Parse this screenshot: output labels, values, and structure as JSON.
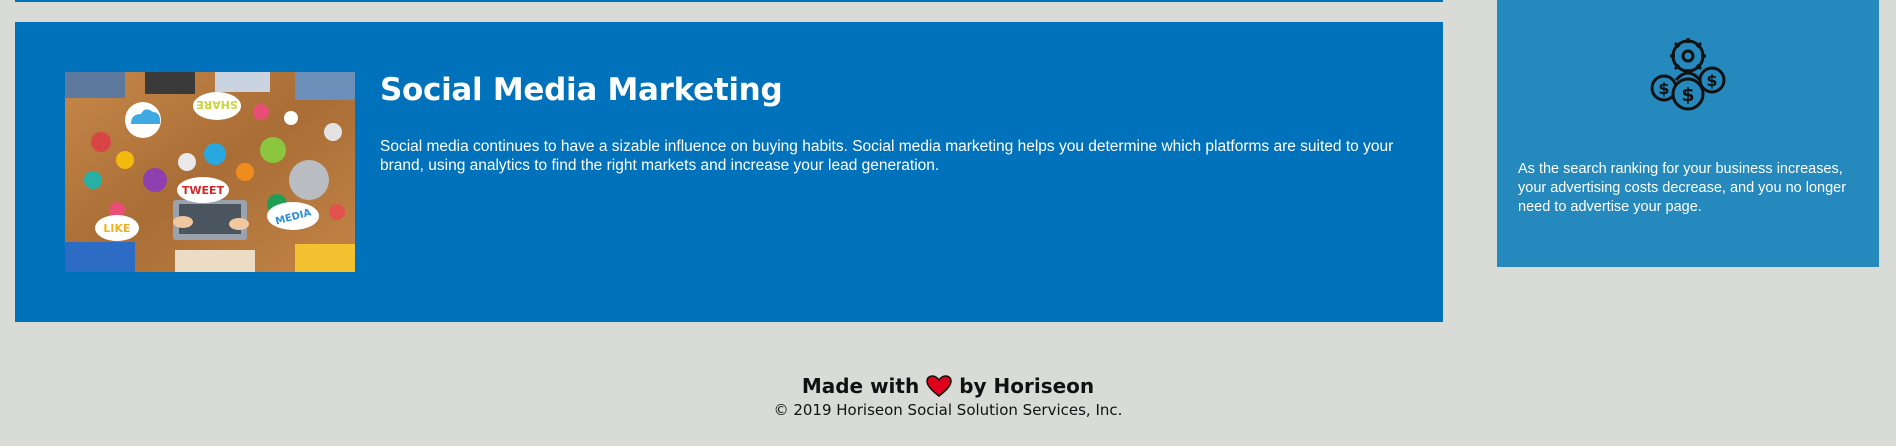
{
  "section": {
    "title": "Social Media Marketing",
    "body": "Social media continues to have a sizable influence on buying habits. Social media marketing helps you determine which platforms are suited to your brand, using analytics to find the right markets and increase your lead generation.",
    "image_alt": "social media marketing",
    "image_words": [
      "SHARE",
      "TWEET",
      "LIKE",
      "MEDIA"
    ]
  },
  "benefit": {
    "icon": "cost-savings-icon",
    "text": "As the search ranking for your business increases, your advertising costs decrease, and you no longer need to advertise your page."
  },
  "footer": {
    "made_with": "Made with",
    "heart_icon": "heart-icon",
    "by": "by Horiseon",
    "copyright": "© 2019 Horiseon Social Solution Services, Inc."
  },
  "colors": {
    "page_background": "#d9dbd7",
    "section_background": "#0072bb",
    "benefit_background": "#2589bd",
    "heart": "#e0001a"
  }
}
